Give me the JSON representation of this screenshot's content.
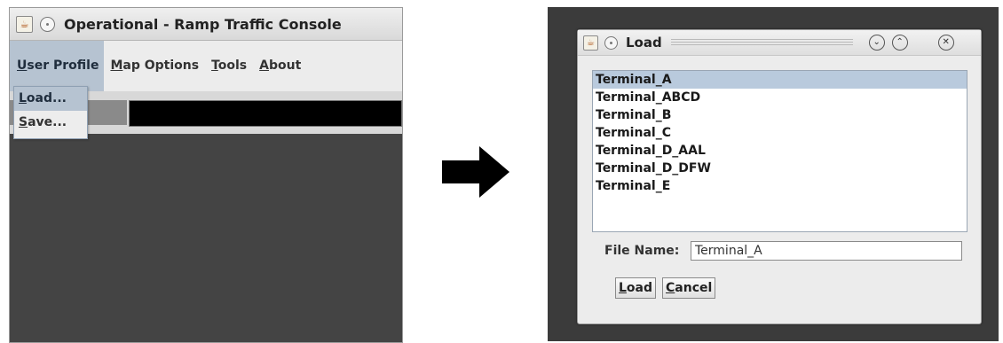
{
  "main_window": {
    "title": "Operational - Ramp Traffic Console",
    "menus": [
      {
        "label": "User Profile",
        "mnemonic": "U",
        "rest": "ser Profile"
      },
      {
        "label": "Map Options",
        "mnemonic": "M",
        "rest": "ap Options"
      },
      {
        "label": "Tools",
        "mnemonic": "T",
        "rest": "ools"
      },
      {
        "label": "About",
        "mnemonic": "A",
        "rest": "bout"
      }
    ],
    "dropdown": [
      {
        "label": "Load...",
        "mnemonic": "L",
        "rest": "oad..."
      },
      {
        "label": "Save...",
        "mnemonic": "S",
        "rest": "ave..."
      }
    ]
  },
  "dialog": {
    "title": "Load",
    "files": [
      "Terminal_A",
      "Terminal_ABCD",
      "Terminal_B",
      "Terminal_C",
      "Terminal_D_AAL",
      "Terminal_D_DFW",
      "Terminal_E"
    ],
    "selected_index": 0,
    "file_name_label": "File Name:",
    "file_name_value": "Terminal_A",
    "load_button": {
      "mnemonic": "L",
      "rest": "oad"
    },
    "cancel_button": {
      "mnemonic": "C",
      "rest": "ancel"
    }
  },
  "icons": {
    "app": "java-icon",
    "window_menu": "window-menu-icon",
    "minimize": "chevron-down-icon",
    "maximize": "chevron-up-icon",
    "close": "close-icon",
    "transition": "arrow-right-icon"
  },
  "colors": {
    "selection": "#b9cadd",
    "dark_background": "#3b3b3b",
    "menu_highlight": "#b6c3d1"
  }
}
